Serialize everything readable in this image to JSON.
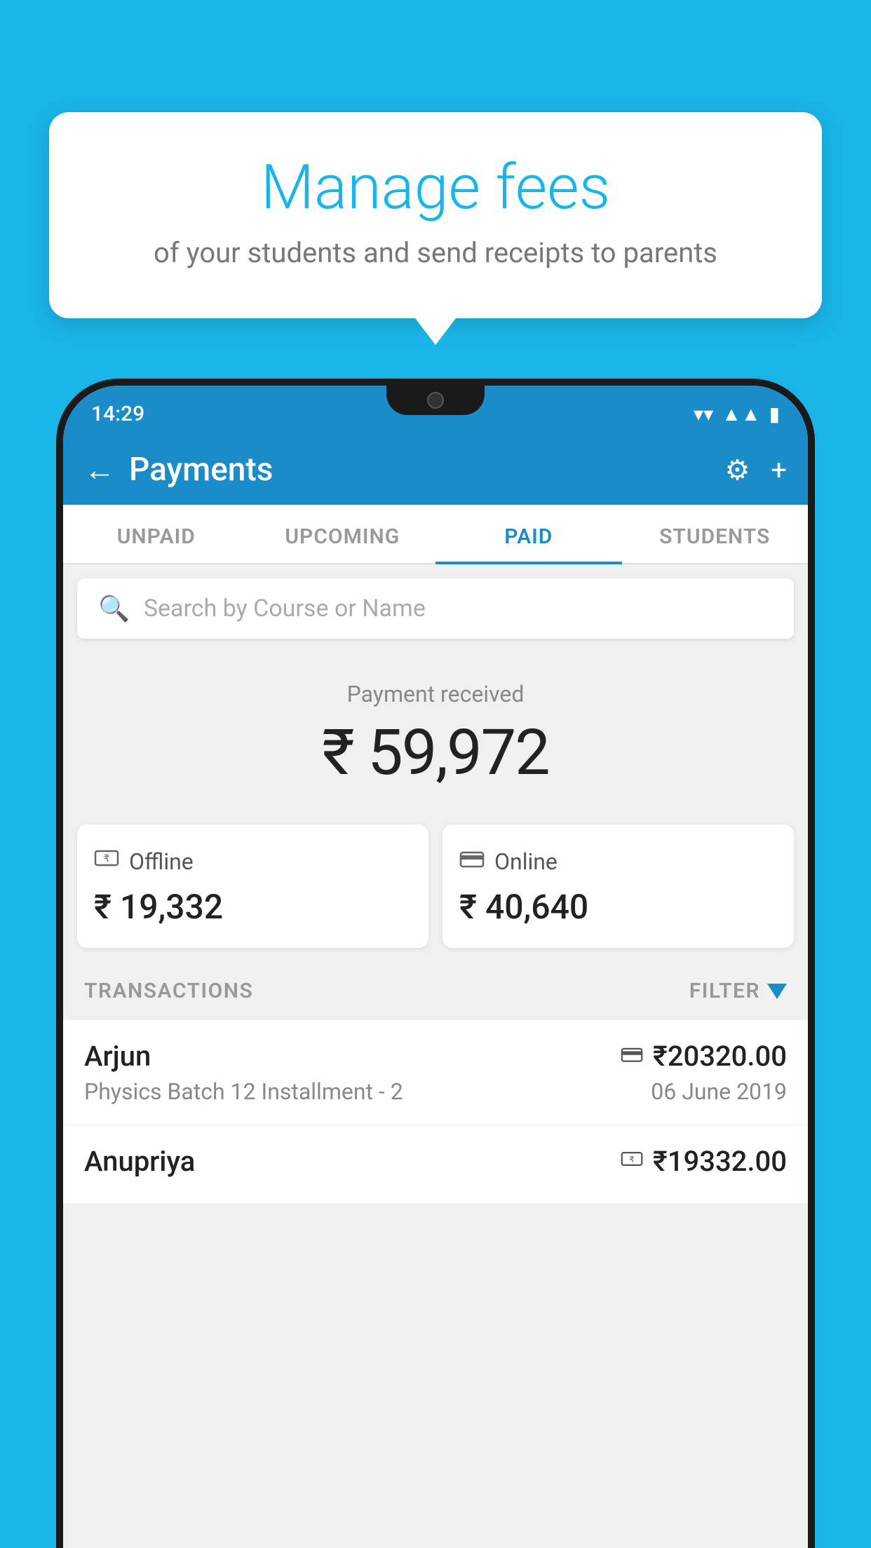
{
  "bubble": {
    "title": "Manage fees",
    "subtitle": "of your students and send receipts to parents"
  },
  "status_bar": {
    "time": "14:29",
    "wifi": "▼",
    "signal": "▲",
    "battery": "▮"
  },
  "header": {
    "title": "Payments",
    "back_icon": "←",
    "settings_icon": "⚙",
    "add_icon": "+"
  },
  "tabs": [
    {
      "label": "UNPAID",
      "active": false
    },
    {
      "label": "UPCOMING",
      "active": false
    },
    {
      "label": "PAID",
      "active": true
    },
    {
      "label": "STUDENTS",
      "active": false
    }
  ],
  "search": {
    "placeholder": "Search by Course or Name"
  },
  "payment_received": {
    "label": "Payment received",
    "amount": "₹ 59,972"
  },
  "payment_cards": [
    {
      "type": "Offline",
      "amount": "₹ 19,332",
      "icon": "💴"
    },
    {
      "type": "Online",
      "amount": "₹ 40,640",
      "icon": "💳"
    }
  ],
  "transactions_section": {
    "label": "TRANSACTIONS",
    "filter_label": "FILTER"
  },
  "transactions": [
    {
      "name": "Arjun",
      "course": "Physics Batch 12 Installment - 2",
      "amount": "₹20320.00",
      "date": "06 June 2019",
      "payment_type": "online"
    },
    {
      "name": "Anupriya",
      "course": "",
      "amount": "₹19332.00",
      "date": "",
      "payment_type": "offline"
    }
  ]
}
